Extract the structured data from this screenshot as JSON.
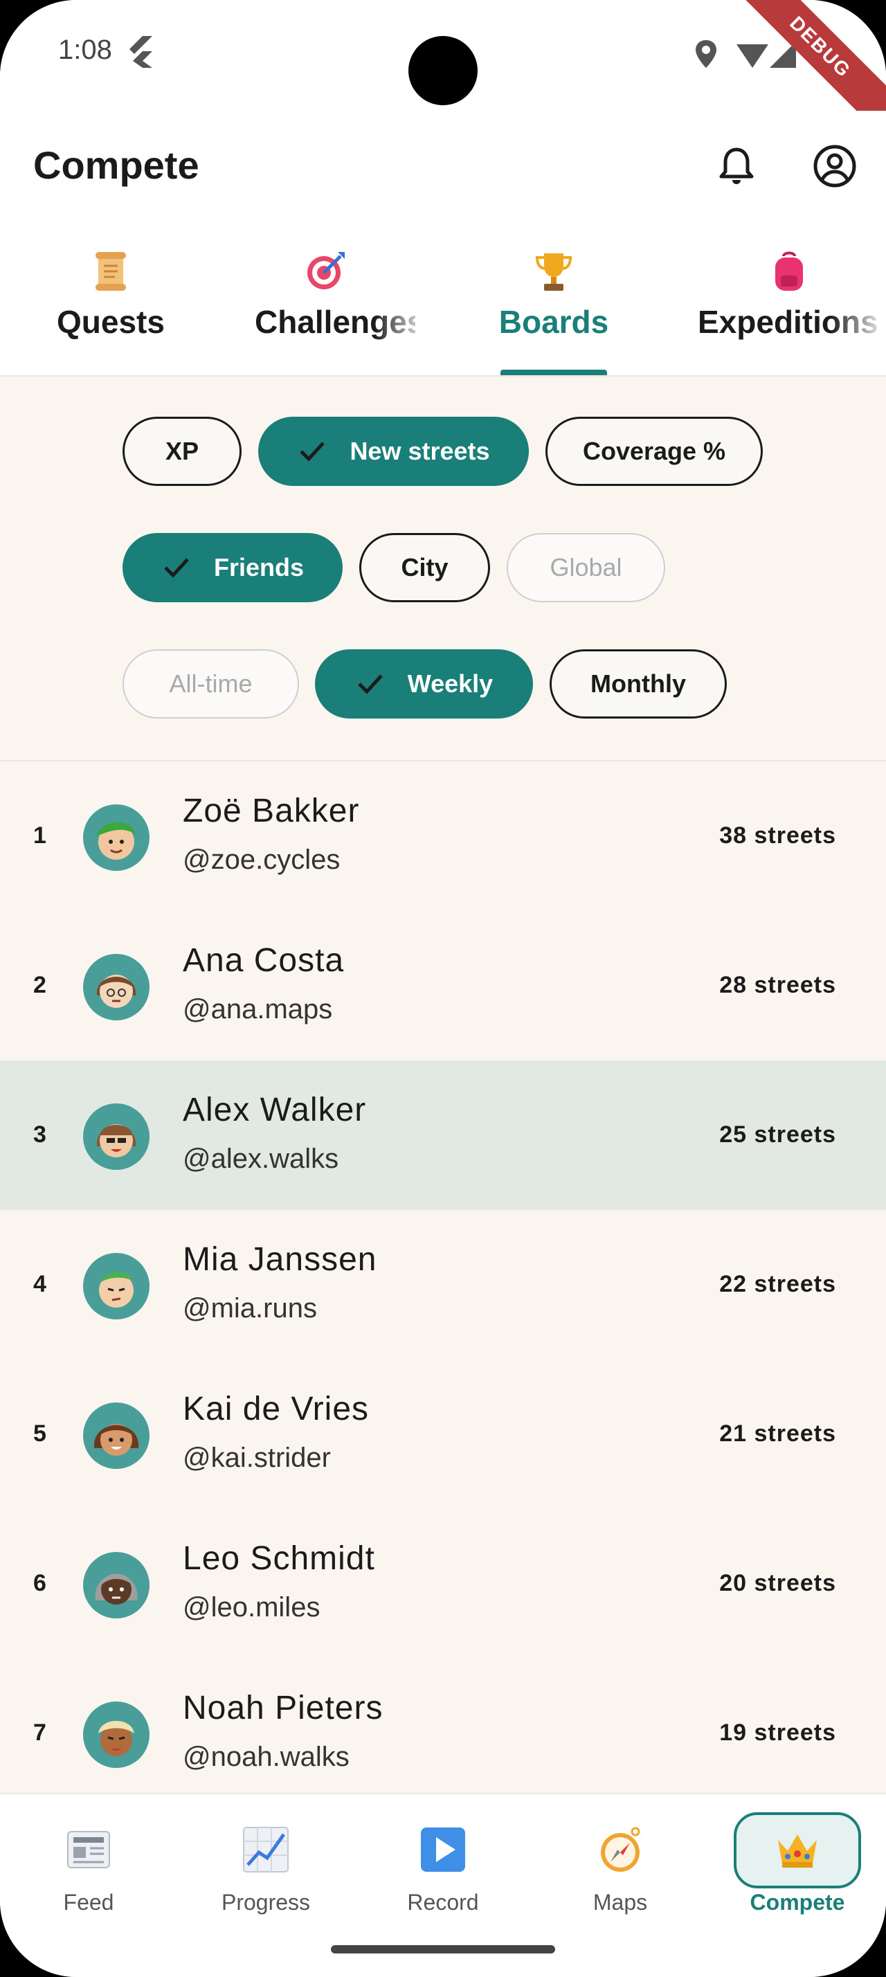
{
  "status_bar": {
    "time": "1:08",
    "debug_banner": "DEBUG"
  },
  "app_bar": {
    "title": "Compete",
    "notifications_icon": "bell-icon",
    "profile_icon": "account-circle-icon"
  },
  "tabs": [
    {
      "label": "Quests",
      "icon": "scroll-icon",
      "active": false
    },
    {
      "label": "Challenges",
      "icon": "target-icon",
      "active": false
    },
    {
      "label": "Boards",
      "icon": "trophy-icon",
      "active": true
    },
    {
      "label": "Expeditions",
      "icon": "backpack-icon",
      "active": false
    }
  ],
  "filters": {
    "metric": [
      {
        "label": "XP",
        "selected": false
      },
      {
        "label": "New streets",
        "selected": true
      },
      {
        "label": "Coverage %",
        "selected": false
      }
    ],
    "scope": [
      {
        "label": "Friends",
        "selected": true
      },
      {
        "label": "City",
        "selected": false
      },
      {
        "label": "Global",
        "selected": false,
        "disabled": true
      }
    ],
    "period": [
      {
        "label": "All-time",
        "selected": false,
        "disabled": true
      },
      {
        "label": "Weekly",
        "selected": true
      },
      {
        "label": "Monthly",
        "selected": false
      }
    ]
  },
  "leaderboard": [
    {
      "rank": "1",
      "name": "Zoë Bakker",
      "handle": "@zoe.cycles",
      "score": "38 streets",
      "is_current_user": false
    },
    {
      "rank": "2",
      "name": "Ana Costa",
      "handle": "@ana.maps",
      "score": "28 streets",
      "is_current_user": false
    },
    {
      "rank": "3",
      "name": "Alex Walker",
      "handle": "@alex.walks",
      "score": "25 streets",
      "is_current_user": true
    },
    {
      "rank": "4",
      "name": "Mia Janssen",
      "handle": "@mia.runs",
      "score": "22 streets",
      "is_current_user": false
    },
    {
      "rank": "5",
      "name": "Kai de Vries",
      "handle": "@kai.strider",
      "score": "21 streets",
      "is_current_user": false
    },
    {
      "rank": "6",
      "name": "Leo Schmidt",
      "handle": "@leo.miles",
      "score": "20 streets",
      "is_current_user": false
    },
    {
      "rank": "7",
      "name": "Noah Pieters",
      "handle": "@noah.walks",
      "score": "19 streets",
      "is_current_user": false
    }
  ],
  "bottom_nav": [
    {
      "label": "Feed",
      "icon": "newspaper-icon",
      "active": false
    },
    {
      "label": "Progress",
      "icon": "chart-icon",
      "active": false
    },
    {
      "label": "Record",
      "icon": "play-icon",
      "active": false
    },
    {
      "label": "Maps",
      "icon": "compass-icon",
      "active": false
    },
    {
      "label": "Compete",
      "icon": "crown-icon",
      "active": true
    }
  ],
  "colors": {
    "accent": "#197f78",
    "background": "#faf6ef",
    "highlight_row": "#e2e9e2",
    "avatar_bg": "#4a9e9a"
  }
}
